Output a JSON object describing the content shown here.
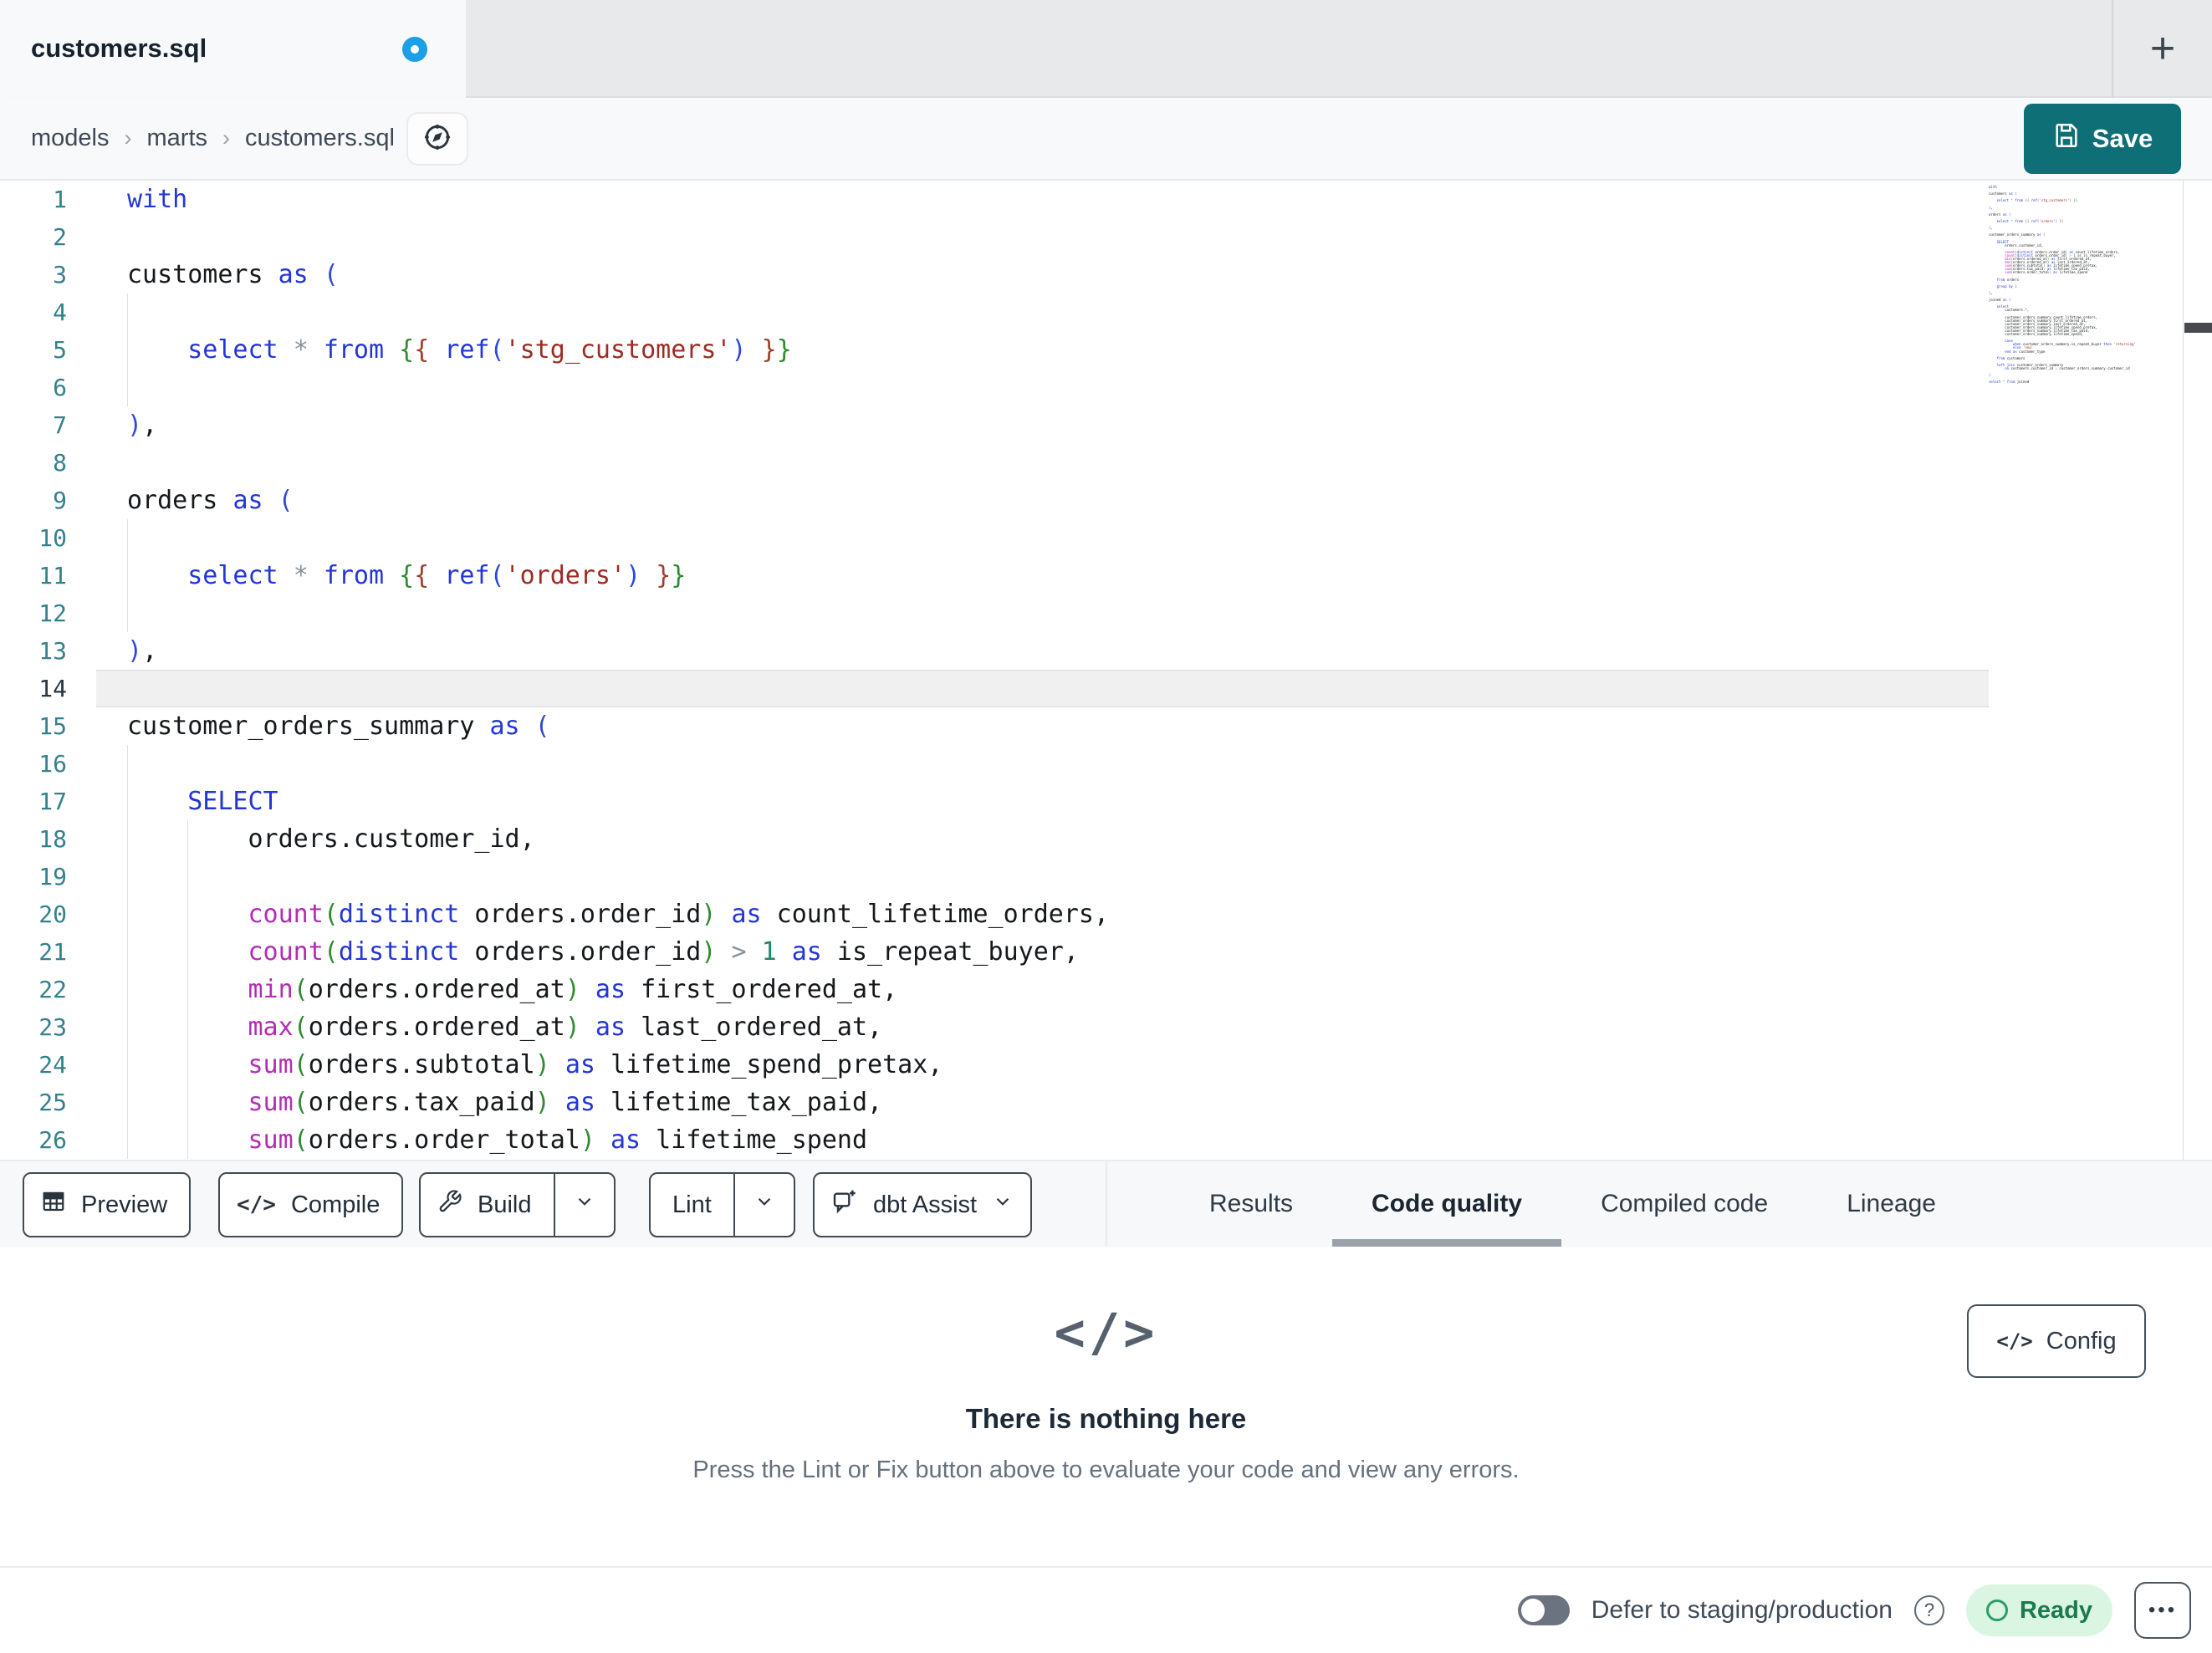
{
  "tab_bar": {
    "active_tab_label": "customers.sql",
    "unsaved": true,
    "new_tab_label": "+"
  },
  "breadcrumb": {
    "items": [
      "models",
      "marts",
      "customers.sql"
    ],
    "separator": "›"
  },
  "actions": {
    "save_label": "Save"
  },
  "editor": {
    "active_line": 14,
    "visible_line_count": 26,
    "code_lines": [
      "with",
      "",
      "customers as (",
      "",
      "    select * from {{ ref('stg_customers') }}",
      "",
      "),",
      "",
      "orders as (",
      "",
      "    select * from {{ ref('orders') }}",
      "",
      "),",
      "",
      "customer_orders_summary as (",
      "",
      "    SELECT",
      "        orders.customer_id,",
      "",
      "        count(distinct orders.order_id) as count_lifetime_orders,",
      "        count(distinct orders.order_id) > 1 as is_repeat_buyer,",
      "        min(orders.ordered_at) as first_ordered_at,",
      "        max(orders.ordered_at) as last_ordered_at,",
      "        sum(orders.subtotal) as lifetime_spend_pretax,",
      "        sum(orders.tax_paid) as lifetime_tax_paid,",
      "        sum(orders.order_total) as lifetime_spend",
      "",
      "    from orders",
      "",
      "    group by 1",
      "",
      "),",
      "",
      "joined as (",
      "",
      "    select",
      "        customers.*,",
      "",
      "        customer_orders_summary.count_lifetime_orders,",
      "        customer_orders_summary.first_ordered_at,",
      "        customer_orders_summary.last_ordered_at,",
      "        customer_orders_summary.lifetime_spend_pretax,",
      "        customer_orders_summary.lifetime_tax_paid,",
      "        customer_orders_summary.lifetime_spend,",
      "",
      "        case",
      "            when customer_orders_summary.is_repeat_buyer then 'returning'",
      "            else 'new'",
      "        end as customer_type",
      "",
      "    from customers",
      "",
      "    left join customer_orders_summary",
      "        on customers.customer_id = customer_orders_summary.customer_id",
      "",
      ")",
      "",
      "select * from joined"
    ]
  },
  "toolbar": {
    "preview_label": "Preview",
    "compile_label": "Compile",
    "compile_icon": "</>",
    "build_label": "Build",
    "lint_label": "Lint",
    "dbt_assist_label": "dbt Assist"
  },
  "panel_tabs": [
    {
      "label": "Results",
      "active": false
    },
    {
      "label": "Code quality",
      "active": true
    },
    {
      "label": "Compiled code",
      "active": false
    },
    {
      "label": "Lineage",
      "active": false
    }
  ],
  "empty_state": {
    "icon": "</>",
    "title": "There is nothing here",
    "subtitle": "Press the Lint or Fix button above to evaluate your code and view any errors."
  },
  "config": {
    "label": "Config",
    "icon": "</>"
  },
  "status_bar": {
    "defer_toggle_on": false,
    "defer_label": "Defer to staging/production",
    "help_icon": "?",
    "ready_label": "Ready",
    "more_label": "•••"
  },
  "colors": {
    "accent_teal": "#0e6f77",
    "unsaved_dot_blue": "#1b9fe6",
    "ready_bg": "#dbf5e3",
    "ready_text": "#1d7a4e",
    "tab_bar_bg": "#e8e9eb",
    "bar_bg": "#f8f9fa",
    "syntax": {
      "keyword": "#2336d6",
      "function": "#b32cb5",
      "string": "#9c2c21",
      "number": "#1d8a6a",
      "operator": "#8a9299",
      "bracket_level_1": "#2d49d8",
      "bracket_level_2": "#2e8b2e",
      "bracket_level_3": "#a0402c",
      "line_number": "#35808e",
      "default_text": "#15181b"
    }
  }
}
